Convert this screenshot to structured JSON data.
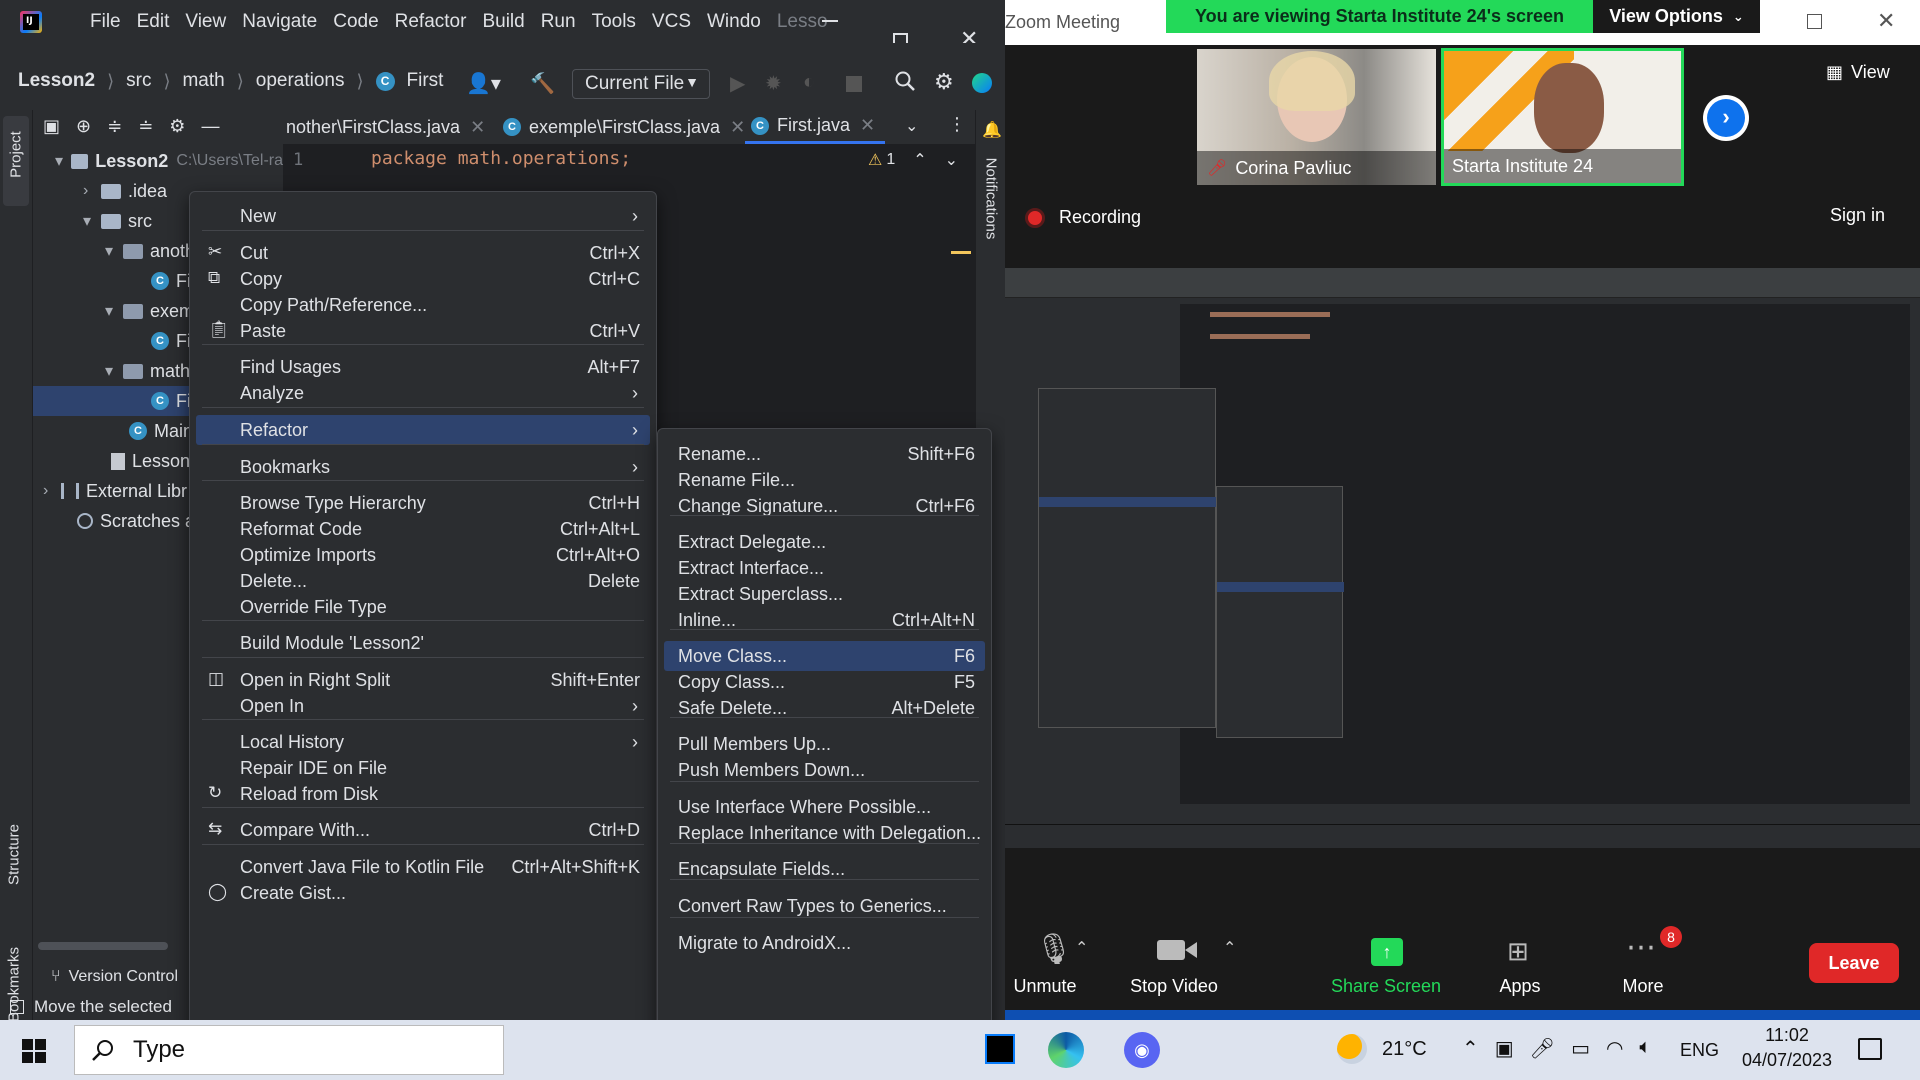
{
  "ide": {
    "menubar": [
      "File",
      "Edit",
      "View",
      "Navigate",
      "Code",
      "Refactor",
      "Build",
      "Run",
      "Tools",
      "VCS",
      "Windo",
      "Lesso"
    ],
    "breadcrumbs": [
      "Lesson2",
      "src",
      "math",
      "operations",
      "First"
    ],
    "run_config": "Current File",
    "left_strip": {
      "project": "Project",
      "structure": "Structure",
      "bookmarks": "Bookmarks"
    },
    "right_strip": {
      "notifications": "Notifications"
    },
    "tree": [
      {
        "label": "Lesson2",
        "extra": "C:\\Users\\Tel-ra",
        "icon": "folder"
      },
      {
        "label": ".idea",
        "icon": "folder"
      },
      {
        "label": "src",
        "icon": "folder"
      },
      {
        "label": "anoth",
        "icon": "package"
      },
      {
        "label": "Fi",
        "icon": "class"
      },
      {
        "label": "exem",
        "icon": "package"
      },
      {
        "label": "Fi",
        "icon": "class"
      },
      {
        "label": "math",
        "icon": "package"
      },
      {
        "label": "Fi",
        "icon": "class"
      },
      {
        "label": "Main",
        "icon": "class"
      },
      {
        "label": "Lesson2.",
        "icon": "file"
      },
      {
        "label": "External Libr",
        "icon": "lib"
      },
      {
        "label": "Scratches ar",
        "icon": "scratch"
      }
    ],
    "tabs": [
      "nother\\FirstClass.java",
      "exemple\\FirstClass.java",
      "First.java"
    ],
    "editor": {
      "line_number": "1",
      "code": "package math.operations;",
      "warning_count": "1"
    },
    "bottom": {
      "version_control": "Version Control",
      "status": "Move the selected"
    }
  },
  "context_menu": {
    "items": [
      {
        "label": "New",
        "shortcut": "",
        "submenu": true
      },
      {
        "label": "Cut",
        "shortcut": "Ctrl+X",
        "icon": "cut-icon"
      },
      {
        "label": "Copy",
        "shortcut": "Ctrl+C",
        "icon": "copy-icon"
      },
      {
        "label": "Copy Path/Reference...",
        "shortcut": ""
      },
      {
        "label": "Paste",
        "shortcut": "Ctrl+V",
        "icon": "paste-icon"
      },
      {
        "label": "Find Usages",
        "shortcut": "Alt+F7"
      },
      {
        "label": "Analyze",
        "shortcut": "",
        "submenu": true
      },
      {
        "label": "Refactor",
        "shortcut": "",
        "submenu": true
      },
      {
        "label": "Bookmarks",
        "shortcut": "",
        "submenu": true
      },
      {
        "label": "Browse Type Hierarchy",
        "shortcut": "Ctrl+H"
      },
      {
        "label": "Reformat Code",
        "shortcut": "Ctrl+Alt+L"
      },
      {
        "label": "Optimize Imports",
        "shortcut": "Ctrl+Alt+O"
      },
      {
        "label": "Delete...",
        "shortcut": "Delete"
      },
      {
        "label": "Override File Type",
        "shortcut": ""
      },
      {
        "label": "Build Module 'Lesson2'",
        "shortcut": ""
      },
      {
        "label": "Open in Right Split",
        "shortcut": "Shift+Enter",
        "icon": "split-icon"
      },
      {
        "label": "Open In",
        "shortcut": "",
        "submenu": true
      },
      {
        "label": "Local History",
        "shortcut": "",
        "submenu": true
      },
      {
        "label": "Repair IDE on File",
        "shortcut": ""
      },
      {
        "label": "Reload from Disk",
        "shortcut": "",
        "icon": "reload-icon"
      },
      {
        "label": "Compare With...",
        "shortcut": "Ctrl+D",
        "icon": "compare-icon"
      },
      {
        "label": "Convert Java File to Kotlin File",
        "shortcut": "Ctrl+Alt+Shift+K"
      },
      {
        "label": "Create Gist...",
        "shortcut": "",
        "icon": "github-icon"
      }
    ]
  },
  "refactor_menu": {
    "items": [
      {
        "label": "Rename...",
        "shortcut": "Shift+F6"
      },
      {
        "label": "Rename File...",
        "shortcut": ""
      },
      {
        "label": "Change Signature...",
        "shortcut": "Ctrl+F6"
      },
      {
        "label": "Extract Delegate...",
        "shortcut": ""
      },
      {
        "label": "Extract Interface...",
        "shortcut": ""
      },
      {
        "label": "Extract Superclass...",
        "shortcut": ""
      },
      {
        "label": "Inline...",
        "shortcut": "Ctrl+Alt+N"
      },
      {
        "label": "Move Class...",
        "shortcut": "F6"
      },
      {
        "label": "Copy Class...",
        "shortcut": "F5"
      },
      {
        "label": "Safe Delete...",
        "shortcut": "Alt+Delete"
      },
      {
        "label": "Pull Members Up...",
        "shortcut": ""
      },
      {
        "label": "Push Members Down...",
        "shortcut": ""
      },
      {
        "label": "Use Interface Where Possible...",
        "shortcut": ""
      },
      {
        "label": "Replace Inheritance with Delegation...",
        "shortcut": ""
      },
      {
        "label": "Encapsulate Fields...",
        "shortcut": ""
      },
      {
        "label": "Convert Raw Types to Generics...",
        "shortcut": ""
      },
      {
        "label": "Migrate to AndroidX...",
        "shortcut": ""
      }
    ]
  },
  "zoom": {
    "window_title": "Zoom Meeting",
    "banner": "You are viewing Starta Institute 24's screen",
    "view_options": "View Options",
    "view_label": "View",
    "participants": [
      {
        "name": "Corina Pavliuc",
        "muted": true
      },
      {
        "name": "Starta Institute 24",
        "muted": false
      }
    ],
    "recording": "Recording",
    "sign_in": "Sign in",
    "controls": {
      "unmute": "Unmute",
      "stop_video": "Stop Video",
      "share_screen": "Share Screen",
      "apps": "Apps",
      "more": "More",
      "more_badge": "8",
      "leave": "Leave"
    },
    "colors": {
      "banner": "#23d959",
      "leave": "#e02828",
      "share": "#23d959"
    }
  },
  "taskbar": {
    "search": "Type",
    "weather": "21°C",
    "language": "ENG",
    "time": "11:02",
    "date": "04/07/2023"
  }
}
